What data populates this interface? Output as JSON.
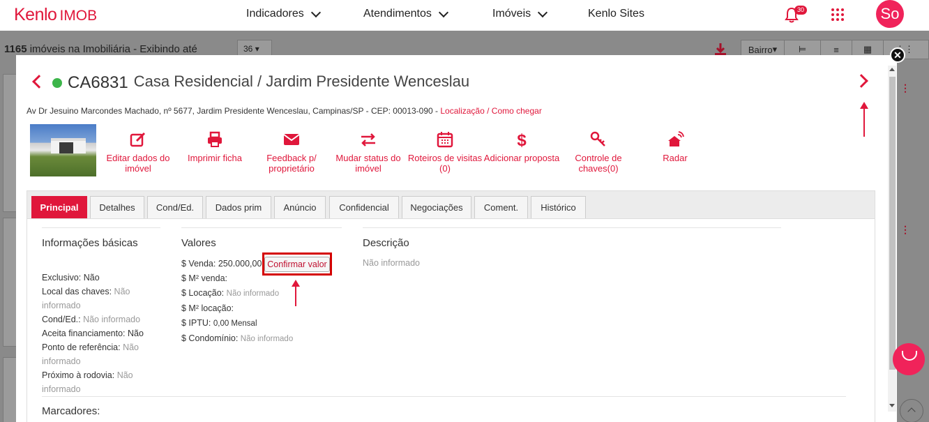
{
  "navbar": {
    "brand": "Kenlo",
    "brand_sub": "IMOB",
    "menu": [
      {
        "label": "Indicadores"
      },
      {
        "label": "Atendimentos"
      },
      {
        "label": "Imóveis"
      },
      {
        "label": "Kenlo Sites"
      }
    ],
    "notifications_count": "30",
    "avatar_initials": "So"
  },
  "background": {
    "count_bold": "1165",
    "count_text": "imóveis na Imobiliária - Exibindo até",
    "per_page": "36",
    "sort_label": "Bairro"
  },
  "property": {
    "code": "CA6831",
    "title": "Casa Residencial / Jardim Presidente Wenceslau",
    "address": "Av Dr Jesuino Marcondes Machado, nº 5677, Jardim Presidente Wenceslau, Campinas/SP - CEP: 00013-090 -",
    "link_location": "Localização",
    "link_sep": "/",
    "link_directions": "Como chegar",
    "status_color": "#3cb54a"
  },
  "actions": [
    {
      "label": "Editar dados do imóvel",
      "icon": "edit-icon"
    },
    {
      "label": "Imprimir ficha",
      "icon": "print-icon"
    },
    {
      "label": "Feedback p/ proprietário",
      "icon": "envelope-icon"
    },
    {
      "label": "Mudar status do imóvel",
      "icon": "exchange-icon"
    },
    {
      "label": "Roteiros de visitas (0)",
      "icon": "calendar-icon"
    },
    {
      "label": "Adicionar proposta",
      "icon": "dollar-icon"
    },
    {
      "label": "Controle de chaves(0)",
      "icon": "key-icon"
    },
    {
      "label": "Radar",
      "icon": "radar-icon"
    }
  ],
  "tabs": [
    {
      "label": "Principal",
      "active": true
    },
    {
      "label": "Detalhes"
    },
    {
      "label": "Cond/Ed."
    },
    {
      "label": "Dados prim"
    },
    {
      "label": "Anúncio"
    },
    {
      "label": "Confidencial"
    },
    {
      "label": "Negociações"
    },
    {
      "label": "Coment."
    },
    {
      "label": "Histórico"
    }
  ],
  "basic_info": {
    "title": "Informações básicas",
    "exclusivo_label": "Exclusivo:",
    "exclusivo_value": "Não",
    "chaves_label": "Local das chaves:",
    "chaves_value_a": "Não",
    "chaves_value_b": "informado",
    "cond_label": "Cond/Ed.:",
    "cond_value": "Não informado",
    "financ_label": "Aceita financiamento:",
    "financ_value": "Não",
    "ref_label": "Ponto de referência:",
    "ref_value_a": "Não",
    "ref_value_b": "informado",
    "rod_label": "Próximo à rodovia:",
    "rod_value_a": "Não",
    "rod_value_b": "informado"
  },
  "values": {
    "title": "Valores",
    "venda_label": "$ Venda:",
    "venda_value": "250.000,00",
    "confirm_button": "Confirmar valor",
    "m2_venda_label": "$ M² venda:",
    "locacao_label": "$ Locação:",
    "locacao_value": "Não informado",
    "m2_locacao_label": "$ M² locação:",
    "iptu_label": "$ IPTU:",
    "iptu_value": "0,00 Mensal",
    "condominio_label": "$ Condomínio:",
    "condominio_value": "Não informado"
  },
  "description": {
    "title": "Descrição",
    "text": "Não informado"
  },
  "marcadores": {
    "title": "Marcadores:"
  },
  "colors": {
    "brand": "#e0173b",
    "annotation_red": "#d40000"
  }
}
